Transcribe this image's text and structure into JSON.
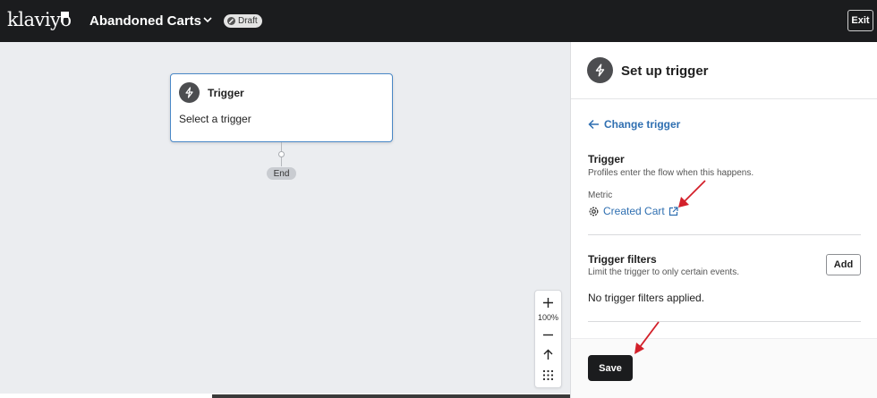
{
  "header": {
    "logo_text": "klaviyo",
    "flow_title": "Abandoned Carts",
    "status_badge": "Draft",
    "exit_label": "Exit"
  },
  "canvas": {
    "trigger_card": {
      "title": "Trigger",
      "subtitle": "Select a trigger"
    },
    "end_label": "End",
    "zoom": {
      "level": "100%"
    }
  },
  "panel": {
    "title": "Set up trigger",
    "change_trigger_label": "Change trigger",
    "trigger_section": {
      "title": "Trigger",
      "description": "Profiles enter the flow when this happens.",
      "metric_label": "Metric",
      "metric_value": "Created Cart"
    },
    "filters_section": {
      "title": "Trigger filters",
      "description": "Limit the trigger to only certain events.",
      "add_label": "Add",
      "empty_text": "No trigger filters applied."
    },
    "save_label": "Save"
  },
  "colors": {
    "topbar": "#1b1c1e",
    "link": "#2f6fb1",
    "card_border": "#4a88c7",
    "annotation_arrow": "#d3202a"
  }
}
